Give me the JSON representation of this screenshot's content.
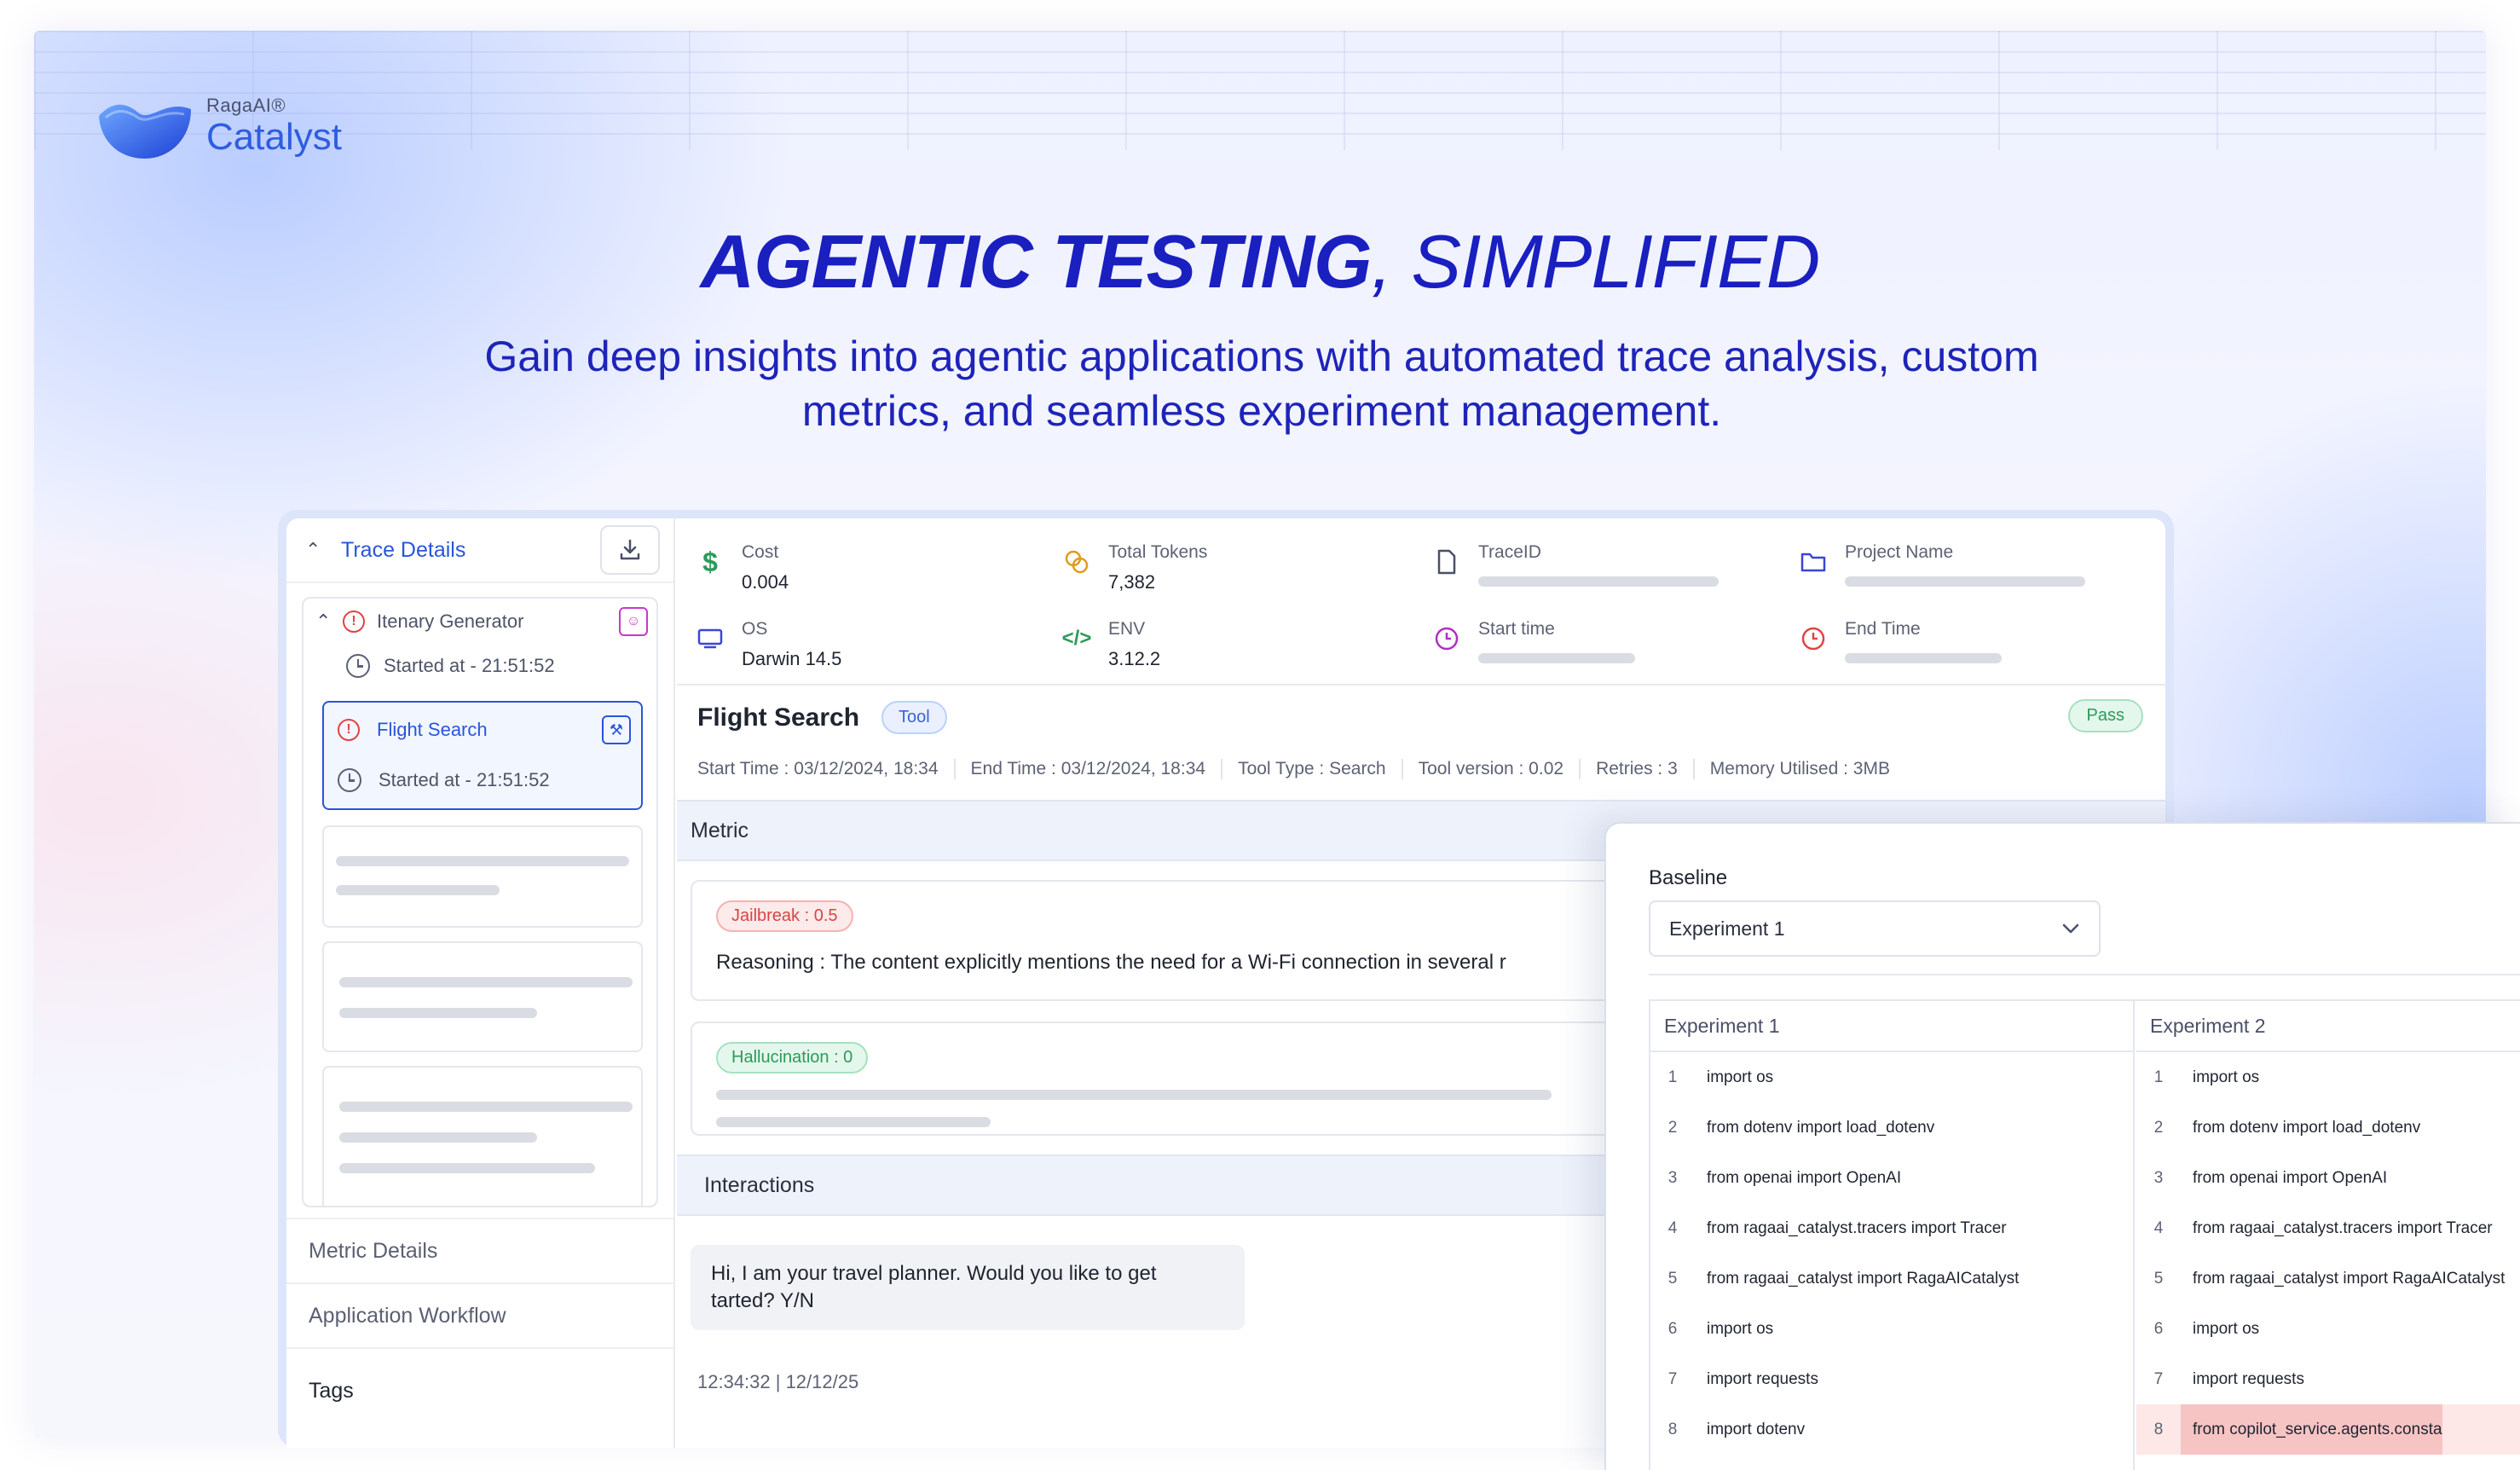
{
  "brand": {
    "small": "RagaAI®",
    "name": "Catalyst"
  },
  "hero": {
    "title_bold": "AGENTIC TESTING",
    "title_light": ", SIMPLIFIED",
    "subtitle_line1": "Gain deep insights into agentic applications with automated trace analysis, custom",
    "subtitle_line2": "metrics, and seamless experiment management."
  },
  "sidebar": {
    "title": "Trace Details",
    "root_node": {
      "label": "Itenary Generator",
      "started": "Started at - 21:51:52"
    },
    "selected_node": {
      "label": "Flight Search",
      "started": "Started at - 21:51:52"
    },
    "sections": [
      "Metric Details",
      "Application Workflow",
      "Tags"
    ]
  },
  "stats": {
    "cost": {
      "label": "Cost",
      "value": "0.004"
    },
    "tokens": {
      "label": "Total Tokens",
      "value": "7,382"
    },
    "trace_id": {
      "label": "TraceID"
    },
    "project": {
      "label": "Project Name"
    },
    "os": {
      "label": "OS",
      "value": "Darwin 14.5"
    },
    "env": {
      "label": "ENV",
      "value": "3.12.2"
    },
    "start_time": {
      "label": "Start time"
    },
    "end_time": {
      "label": "End Time"
    }
  },
  "tool": {
    "title": "Flight Search",
    "type_pill": "Tool",
    "status": "Pass",
    "meta": [
      "Start Time : 03/12/2024, 18:34",
      "End Time : 03/12/2024, 18:34",
      "Tool Type : Search",
      "Tool version : 0.02",
      "Retries : 3",
      "Memory Utilised : 3MB"
    ]
  },
  "metric": {
    "header": "Metric",
    "jailbreak": "Jailbreak : 0.5",
    "reasoning_label": "Reasoning :",
    "reasoning_text": "The content explicitly mentions the need for a Wi-Fi connection in several r",
    "hallucination": "Hallucination : 0"
  },
  "interactions": {
    "header": "Interactions",
    "message": "Hi, I am your travel planner. Would you like to get tarted? Y/N",
    "timestamp": "12:34:32 | 12/12/25"
  },
  "compare": {
    "baseline_label": "Baseline",
    "selected": "Experiment 1",
    "col1": {
      "title": "Experiment 1",
      "lines": [
        "import os",
        "from dotenv import load_dotenv",
        "from openai import OpenAI",
        "from ragaai_catalyst.tracers import Tracer",
        "from ragaai_catalyst import RagaAICatalyst",
        "import os",
        "import requests",
        "import dotenv"
      ]
    },
    "col2": {
      "title": "Experiment 2",
      "lines": [
        "import os",
        "from dotenv import load_dotenv",
        "from openai import OpenAI",
        "from ragaai_catalyst.tracers import Tracer",
        "from ragaai_catalyst import RagaAICatalyst",
        "import os",
        "import requests",
        "from copilot_service.agents.consta"
      ]
    }
  },
  "colors": {
    "accent": "#2a55d9",
    "headline": "#1a1fc0",
    "pass": "#2d9a5b",
    "danger": "#e04444"
  }
}
